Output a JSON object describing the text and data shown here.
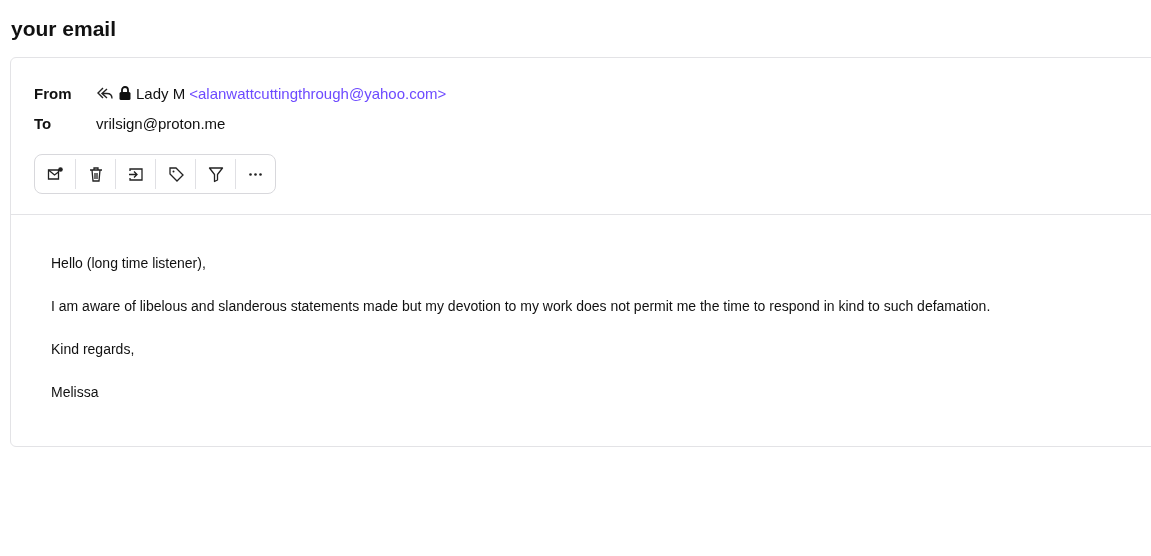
{
  "page_title": "your email",
  "header": {
    "from_label": "From",
    "sender_name": "Lady M",
    "sender_address": "<alanwattcuttingthrough@yahoo.com>",
    "to_label": "To",
    "recipient": "vrilsign@proton.me"
  },
  "body": [
    "Hello (long time listener),",
    "I am aware of libelous and slanderous statements made but my devotion to my work does not permit me the time to respond in kind to such defamation.",
    "Kind regards,",
    "Melissa"
  ]
}
